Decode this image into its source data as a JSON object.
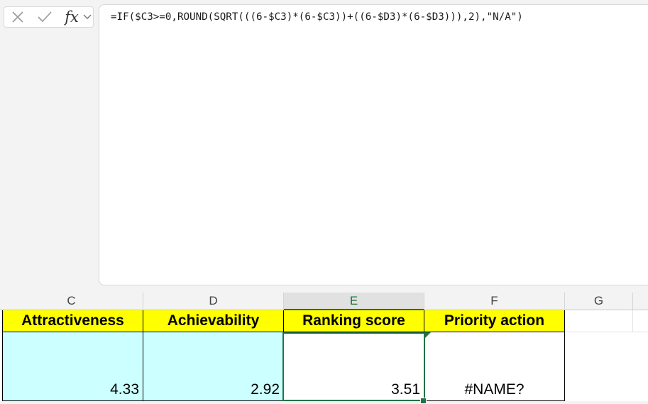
{
  "formula_bar": {
    "cancel_icon": "close-icon",
    "enter_icon": "checkmark-icon",
    "fx_label": "fx",
    "formula": "=IF($C3>=0,ROUND(SQRT(((6-$C3)*(6-$C3))+((6-$D3)*(6-$D3))),2),\"N/A\")"
  },
  "columns": [
    {
      "letter": "C",
      "header": "Attractiveness",
      "value": "4.33"
    },
    {
      "letter": "D",
      "header": "Achievability",
      "value": "2.92"
    },
    {
      "letter": "E",
      "header": "Ranking score",
      "value": "3.51"
    },
    {
      "letter": "F",
      "header": "Priority action",
      "value": "#NAME?"
    },
    {
      "letter": "G"
    }
  ],
  "active_column": "E",
  "colors": {
    "header_fill": "#ffff00",
    "cyan_fill": "#ccffff",
    "selection": "#217346"
  }
}
